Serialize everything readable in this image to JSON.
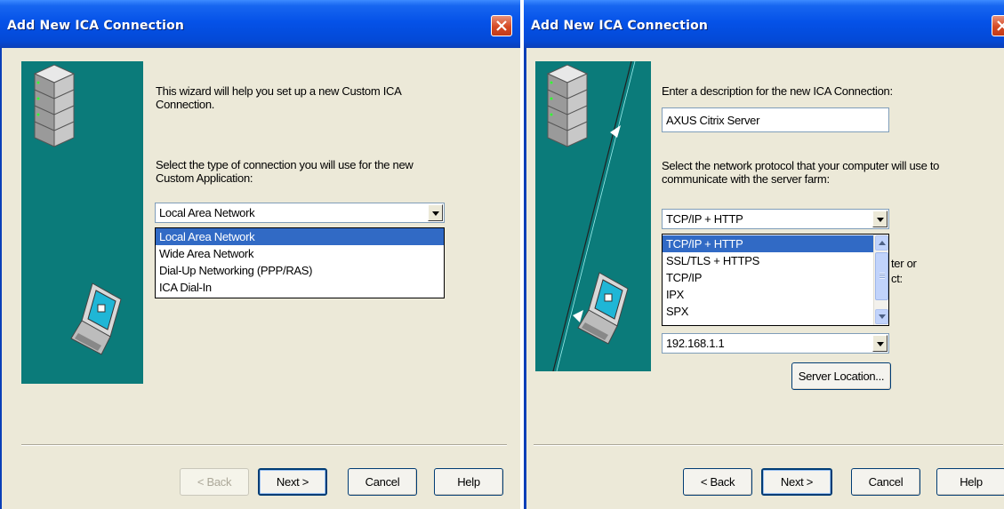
{
  "left_window": {
    "title": "Add New ICA Connection",
    "intro_text": "This wizard will help you set up a new Custom ICA Connection.",
    "connection_prompt": "Select the type of connection you will use for the new Custom Application:",
    "connection_type": {
      "selected": "Local Area Network",
      "options": [
        "Local Area Network",
        "Wide Area Network",
        "Dial-Up Networking (PPP/RAS)",
        "ICA Dial-In"
      ]
    },
    "buttons": {
      "back": "< Back",
      "next": "Next >",
      "cancel": "Cancel",
      "help": "Help"
    }
  },
  "right_window": {
    "title": "Add New ICA Connection",
    "description_prompt": "Enter a description for the new ICA Connection:",
    "description_value": "AXUS Citrix Server",
    "protocol_prompt": "Select the network protocol that your computer will use to communicate with the server farm:",
    "protocol": {
      "selected": "TCP/IP + HTTP",
      "options": [
        "TCP/IP + HTTP",
        "SSL/TLS + HTTPS",
        "TCP/IP",
        "IPX",
        "SPX"
      ]
    },
    "obscured_text_line1": "ter or",
    "obscured_text_line2": "ct:",
    "server_value": "192.168.1.1",
    "server_location_button": "Server Location...",
    "buttons": {
      "back": "< Back",
      "next": "Next >",
      "cancel": "Cancel",
      "help": "Help"
    }
  },
  "colors": {
    "title_blue": "#0552e8",
    "panel_teal": "#0b7b7a",
    "dialog_bg": "#ece9d8",
    "selection": "#316ac5"
  }
}
